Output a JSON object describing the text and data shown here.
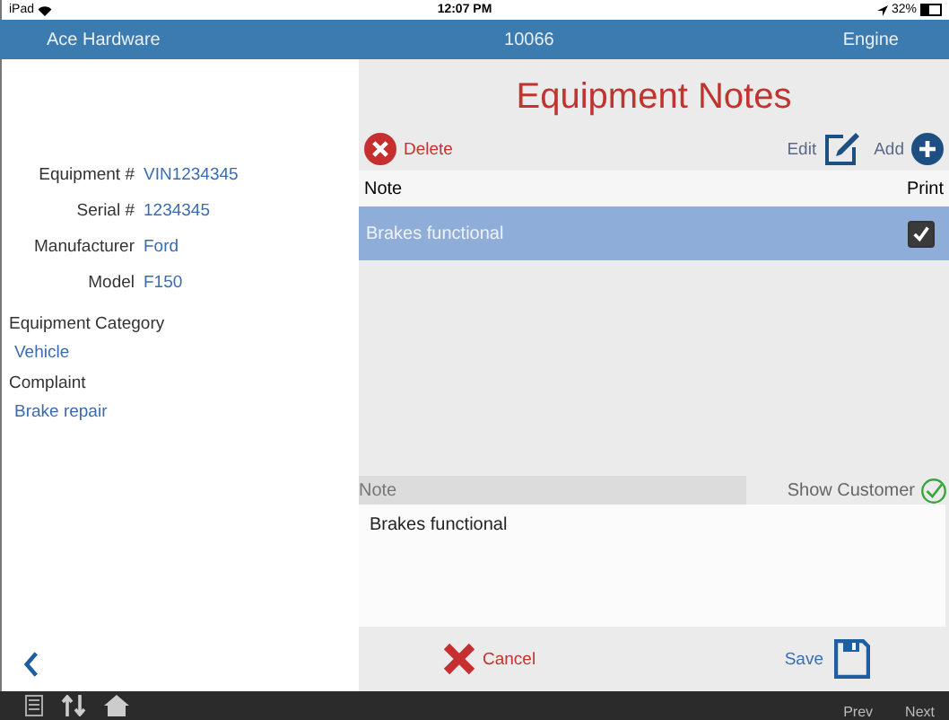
{
  "status_bar": {
    "device": "iPad",
    "time": "12:07 PM",
    "battery": "32%"
  },
  "header": {
    "customer": "Ace Hardware",
    "number": "10066",
    "section": "Engine"
  },
  "details": {
    "fields": [
      {
        "label": "Equipment #",
        "value": "VIN1234345"
      },
      {
        "label": "Serial #",
        "value": "1234345"
      },
      {
        "label": "Manufacturer",
        "value": "Ford"
      },
      {
        "label": "Model",
        "value": "F150"
      }
    ],
    "blocks": [
      {
        "label": "Equipment Category",
        "value": "Vehicle"
      },
      {
        "label": "Complaint",
        "value": "Brake repair"
      }
    ]
  },
  "title": "Equipment Notes",
  "toolbar": {
    "delete": "Delete",
    "edit": "Edit",
    "add": "Add"
  },
  "table": {
    "columns": [
      "Note",
      "Print"
    ],
    "rows": [
      {
        "note": "Brakes functional",
        "print": true,
        "selected": true
      }
    ]
  },
  "editor": {
    "label": "Note",
    "show_customer": "Show Customer",
    "show_customer_checked": true,
    "value": "Brakes functional"
  },
  "actions": {
    "cancel": "Cancel",
    "save": "Save"
  },
  "bottom_bar": {
    "prev": "Prev",
    "next": "Next"
  }
}
